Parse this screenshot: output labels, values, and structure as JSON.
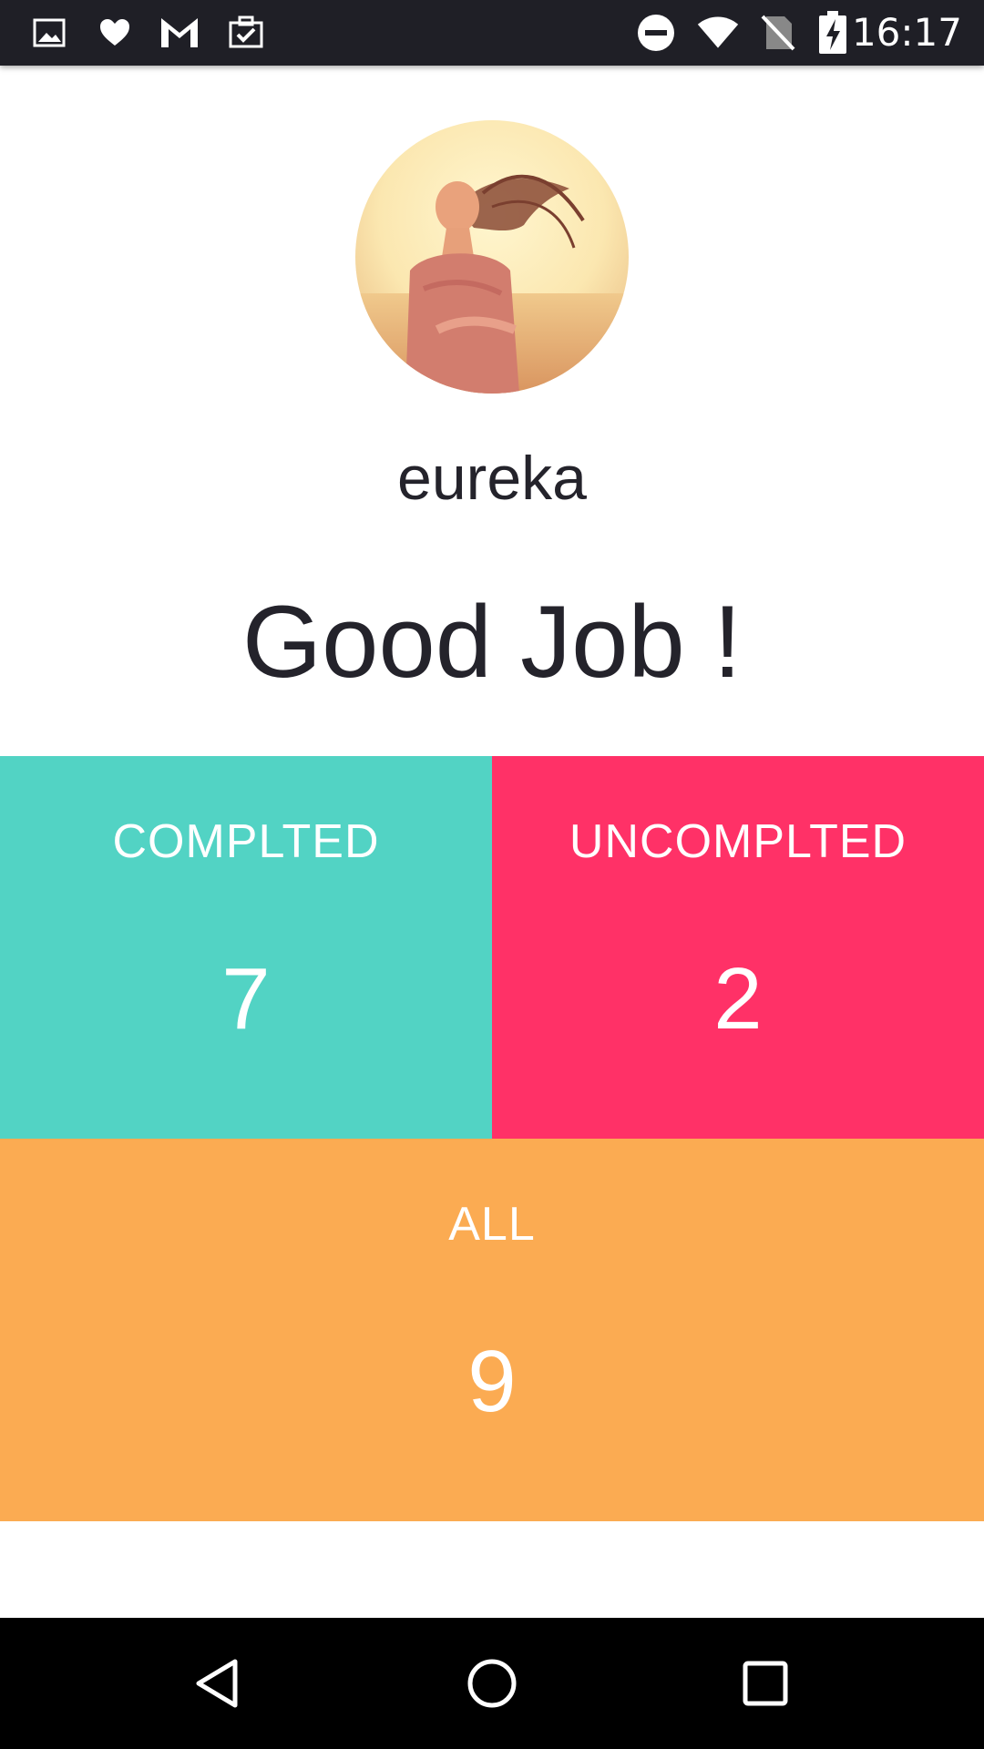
{
  "status_bar": {
    "time": "16:17",
    "left_icons": [
      "image-notification-icon",
      "heart-notification-icon",
      "gmail-icon",
      "briefcase-check-icon"
    ],
    "right_icons": [
      "do-not-disturb-icon",
      "wifi-icon",
      "no-sim-icon",
      "battery-charging-icon"
    ]
  },
  "profile": {
    "avatar_icon": "user-avatar-photo",
    "username": "eureka",
    "headline": "Good Job !"
  },
  "stats": {
    "completed": {
      "label": "COMPLTED",
      "value": "7",
      "color": "#52d3c4"
    },
    "uncompleted": {
      "label": "UNCOMPLTED",
      "value": "2",
      "color": "#ff3167"
    },
    "all": {
      "label": "ALL",
      "value": "9",
      "color": "#fbab52"
    }
  },
  "nav_bar": {
    "buttons": [
      "back-icon",
      "home-icon",
      "recents-icon"
    ]
  },
  "colors": {
    "status_bar_bg": "#1f1f26",
    "text_dark": "#24232b",
    "nav_bar_bg": "#000000"
  }
}
